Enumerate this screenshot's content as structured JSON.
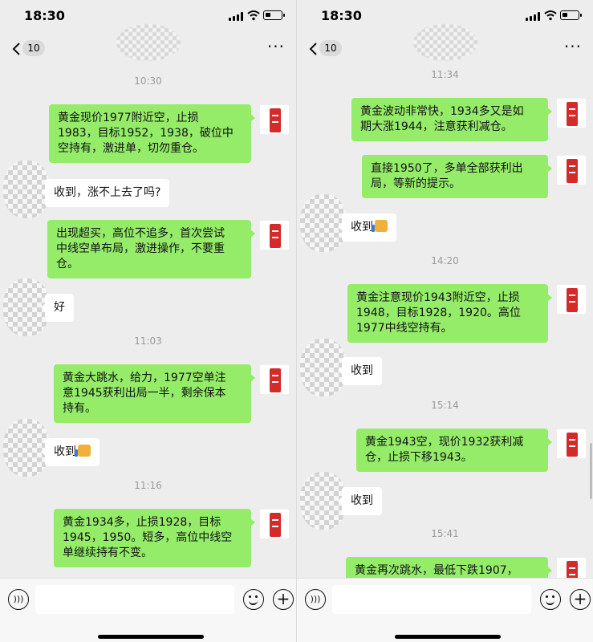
{
  "status_bar": {
    "time": "18:30"
  },
  "nav": {
    "back_count": "10",
    "more_label": "···"
  },
  "left": {
    "messages": [
      {
        "kind": "time",
        "text": "10:30"
      },
      {
        "kind": "out",
        "text": "黄金现价1977附近空，止损\n1983，目标1952，1938，破位中\n空持有，激进单，切勿重仓。"
      },
      {
        "kind": "in",
        "text": "收到，涨不上去了吗?"
      },
      {
        "kind": "out",
        "text": "出现超买，高位不追多，首次尝试\n中线空单布局，激进操作，不要重\n仓。"
      },
      {
        "kind": "in",
        "text": "好"
      },
      {
        "kind": "time",
        "text": "11:03"
      },
      {
        "kind": "out",
        "text": "黄金大跳水，给力，1977空单注\n意1945获利出局一半，剩余保本\n持有。"
      },
      {
        "kind": "in",
        "text": "收到",
        "thumb": true
      },
      {
        "kind": "time",
        "text": "11:16"
      },
      {
        "kind": "out",
        "text": "黄金1934多，止损1928，目标\n1945，1950。短多，高位中线空\n单继续持有不变。"
      }
    ]
  },
  "right": {
    "messages": [
      {
        "kind": "time",
        "text": "11:34"
      },
      {
        "kind": "out",
        "text": "黄金波动非常快，1934多又是如\n期大涨1944，注意获利减仓。"
      },
      {
        "kind": "out",
        "text": "直接1950了，多单全部获利出\n局，等新的提示。"
      },
      {
        "kind": "in",
        "text": "收到",
        "thumb": true
      },
      {
        "kind": "time",
        "text": "14:20"
      },
      {
        "kind": "out",
        "text": "黄金注意现价1943附近空，止损\n1948，目标1928，1920。高位\n1977中线空持有。"
      },
      {
        "kind": "in",
        "text": "收到"
      },
      {
        "kind": "time",
        "text": "15:14"
      },
      {
        "kind": "out",
        "text": "黄金1943空，现价1932获利减\n仓，止损下移1943。"
      },
      {
        "kind": "in",
        "text": "收到"
      },
      {
        "kind": "time",
        "text": "15:41"
      },
      {
        "kind": "out",
        "text": "黄金再次跳水，最低下跌1907，"
      }
    ]
  },
  "input": {
    "voice_icon": "voice-icon",
    "emoji_icon": "emoji-icon",
    "plus_icon": "plus-icon"
  },
  "colors": {
    "outgoing_bubble": "#95ec69",
    "incoming_bubble": "#ffffff",
    "background": "#ededed"
  }
}
